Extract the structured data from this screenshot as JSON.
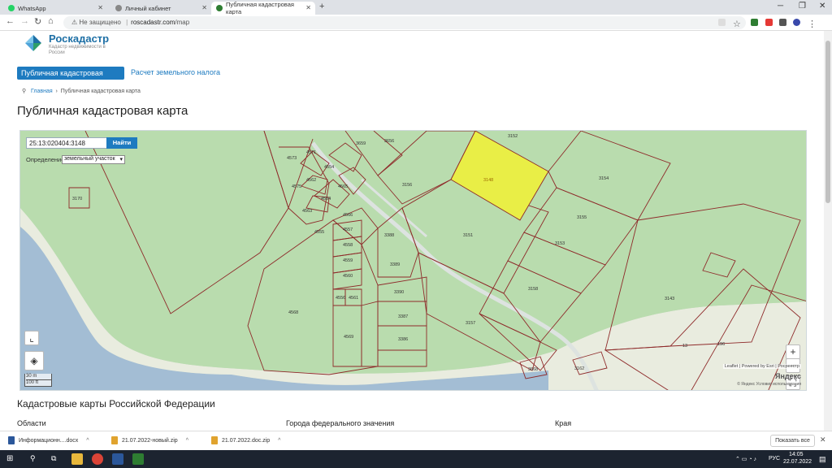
{
  "browser": {
    "tabs": [
      {
        "label": "WhatsApp",
        "active": false,
        "icon": "whatsapp-icon",
        "color": "#25d366"
      },
      {
        "label": "Личный кабинет",
        "active": false,
        "icon": "globe-icon",
        "color": "#888888"
      },
      {
        "label": "Публичная кадастровая карта",
        "active": true,
        "icon": "rosreestr-icon",
        "color": "#2e7d32"
      }
    ],
    "not_secure": "Не защищено",
    "url_host": "roscadastr.com",
    "url_path": "/map"
  },
  "site": {
    "brand": "Роскадастр",
    "brand_sub": "Кадастр недвижимости в России",
    "nav_active": "Публичная кадастровая карта",
    "nav_link": "Расчет земельного налога",
    "breadcrumb_home": "Главная",
    "breadcrumb_current": "Публичная кадастровая карта",
    "page_title": "Публичная кадастровая карта",
    "accent": "#1e7bc0"
  },
  "map": {
    "search_value": "25:13:020404:3148",
    "search_button": "Найти",
    "definition_label": "Определение",
    "definition_value": "земельный участок",
    "zoom_in": "+",
    "zoom_out": "−",
    "scale_m": "30 m",
    "scale_ft": "100 ft",
    "attribution": "Leaflet | Powered by Esri | Росреестр",
    "yandex": "Яндекс",
    "yandex_terms": "© Яндекс Условия использования",
    "selected_parcel": "3148",
    "parcels": [
      "3152",
      "3154",
      "3156",
      "3155",
      "3153",
      "3151",
      "3158",
      "3157",
      "3389",
      "3390",
      "3387",
      "3386",
      "3388",
      "4573",
      "4571",
      "4554",
      "4562",
      "4575",
      "4565",
      "4564",
      "4563",
      "4557",
      "4558",
      "4559",
      "4560",
      "4556",
      "4561",
      "4566",
      "4555",
      "4568",
      "4569",
      "3656",
      "3659",
      "3143",
      "3162",
      "196",
      "13",
      "3668",
      "3170"
    ]
  },
  "sections": {
    "heading": "Кадастровые карты Российской Федерации",
    "cols": [
      "Области",
      "Города федерального значения",
      "Края"
    ]
  },
  "downloads": {
    "items": [
      "Информационн....docx",
      "21.07.2022-новый.zip",
      "21.07.2022.doc.zip"
    ],
    "show_all": "Показать все"
  },
  "taskbar": {
    "lang": "РУС",
    "time": "14:05",
    "date": "22.07.2022"
  }
}
